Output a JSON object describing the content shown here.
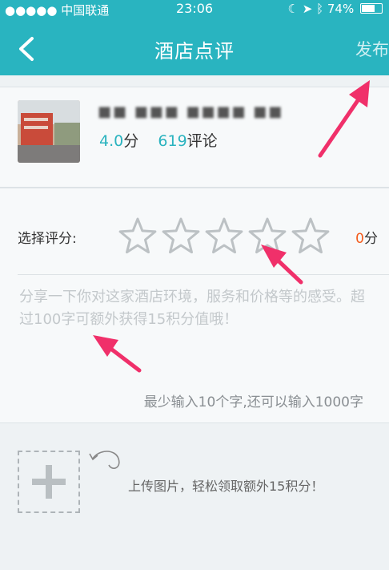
{
  "status_bar": {
    "carrier": "●●●●● 中国联通",
    "time": "23:06",
    "battery": "74%",
    "battery_level": 0.74
  },
  "nav": {
    "title": "酒店点评",
    "publish_label": "发布"
  },
  "hotel": {
    "rating": "4.0",
    "rating_unit": "分",
    "review_count": "619",
    "review_unit": "评论"
  },
  "rating": {
    "label": "选择评分:",
    "score": "0",
    "score_unit": "分",
    "max_stars": 5,
    "selected": 0
  },
  "comment": {
    "placeholder": "分享一下你对这家酒店环境，服务和价格等的感受。超过100字可额外获得15积分值哦！",
    "limit_hint": "最少输入10个字,还可以输入1000字"
  },
  "upload": {
    "hint": "上传图片，轻松领取额外15积分！"
  },
  "colors": {
    "header": "#29b4c0",
    "accent": "#2ab3bf",
    "score_zero": "#f45a1a",
    "arrow": "#f0306a"
  }
}
